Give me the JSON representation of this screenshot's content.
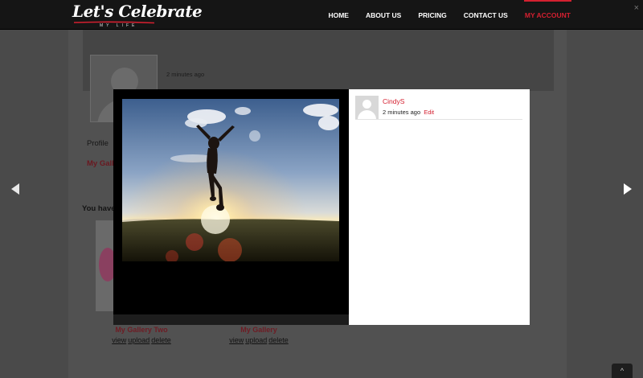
{
  "header": {
    "logo_text": "Let's Celebrate",
    "logo_subtext": "MY LIFE",
    "nav": [
      {
        "label": "HOME"
      },
      {
        "label": "ABOUT US"
      },
      {
        "label": "PRICING"
      },
      {
        "label": "CONTACT US"
      },
      {
        "label": "MY ACCOUNT",
        "active": true
      }
    ],
    "close_icon": "×"
  },
  "background": {
    "profile_time": "2 minutes ago",
    "tab_profile": "Profile",
    "tab_gallery_partial": "My Gall",
    "you_have_partial": "You have",
    "galleries": [
      {
        "title": "My Gallery Two",
        "links": [
          "view",
          "upload",
          "delete"
        ]
      },
      {
        "title": "My Gallery",
        "links": [
          "view",
          "upload",
          "delete"
        ]
      }
    ]
  },
  "lightbox": {
    "comment": {
      "author": "CindyS",
      "time": "2 minutes ago",
      "edit_label": "Edit"
    }
  },
  "icons": {
    "prev": "arrow-left-icon",
    "next": "arrow-right-icon",
    "scroll_top": "^"
  },
  "colors": {
    "accent": "#d42030",
    "header_bg": "#151515",
    "overlay_bg": "#4a4a4a"
  }
}
